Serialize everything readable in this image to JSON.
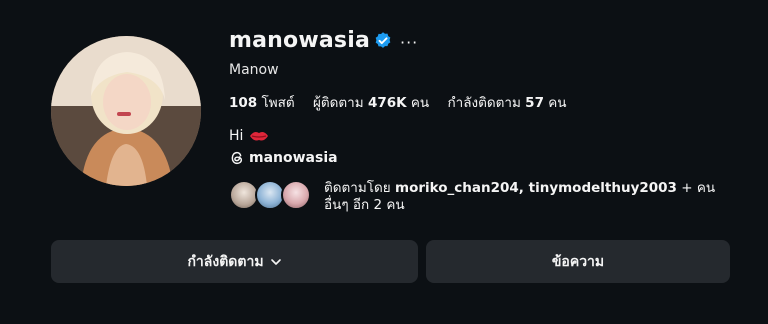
{
  "profile": {
    "username": "manowasia",
    "display_name": "Manow",
    "more_label": "···",
    "verified_icon": "verified-badge-icon",
    "accent_color": "#1d9bf0"
  },
  "stats": {
    "posts_count": "108",
    "posts_label": "โพสต์",
    "followers_label": "ผู้ติดตาม",
    "followers_count": "476K",
    "followers_unit": "คน",
    "following_label": "กำลังติดตาม",
    "following_count": "57",
    "following_unit": "คน"
  },
  "bio": {
    "text": "Hi",
    "emoji_icon": "red-lips-icon"
  },
  "threads": {
    "handle": "manowasia",
    "icon": "threads-icon"
  },
  "followed_by": {
    "prefix": "ติดตามโดย ",
    "names": "moriko_chan204, tinymodelthuy2003",
    "suffix": " + คน อื่นๆ อีก 2 คน"
  },
  "buttons": {
    "following_label": "กำลังติดตาม",
    "message_label": "ข้อความ"
  }
}
